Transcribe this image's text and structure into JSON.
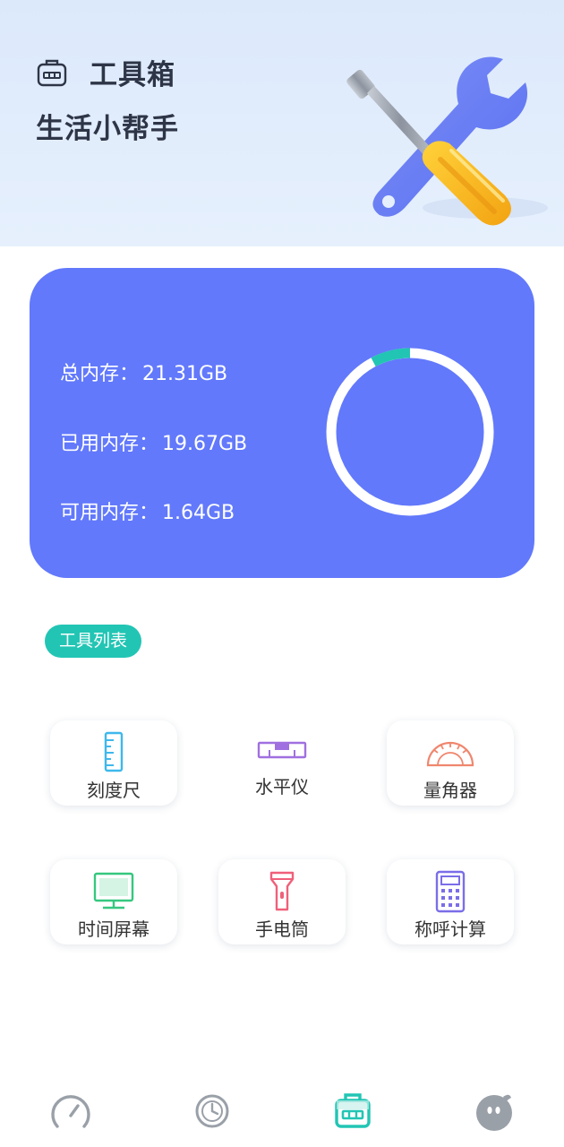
{
  "header": {
    "title": "工具箱",
    "subtitle": "生活小帮手",
    "icon": "toolbox-icon",
    "illustration": "wrench-screwdriver-icon"
  },
  "memory": {
    "total_label": "总内存：",
    "total_value": "21.31GB",
    "used_label": "已用内存：",
    "used_value": "19.67GB",
    "free_label": "可用内存：",
    "free_value": "1.64GB",
    "ring_fraction_free": 0.077,
    "colors": {
      "card": "#6279fb",
      "ring_track": "#ffffff",
      "ring_segment": "#22c5b4"
    }
  },
  "section": {
    "label": "工具列表",
    "color": "#22c5b4"
  },
  "tools": [
    {
      "label": "刻度尺",
      "icon": "ruler-icon",
      "color": "#3eb8ec"
    },
    {
      "label": "水平仪",
      "icon": "spirit-level-icon",
      "color": "#a070e0"
    },
    {
      "label": "量角器",
      "icon": "protractor-icon",
      "color": "#f0866e"
    },
    {
      "label": "时间屏幕",
      "icon": "monitor-icon",
      "color": "#35c77f"
    },
    {
      "label": "手电筒",
      "icon": "flashlight-icon",
      "color": "#f0607a"
    },
    {
      "label": "称呼计算",
      "icon": "calculator-icon",
      "color": "#7a6ee8"
    }
  ],
  "nav": [
    {
      "icon": "speedometer-icon",
      "active": false
    },
    {
      "icon": "clean-dial-icon",
      "active": false
    },
    {
      "icon": "toolbox-icon",
      "active": true,
      "color": "#22c5b4"
    },
    {
      "icon": "profile-face-icon",
      "active": false
    }
  ]
}
